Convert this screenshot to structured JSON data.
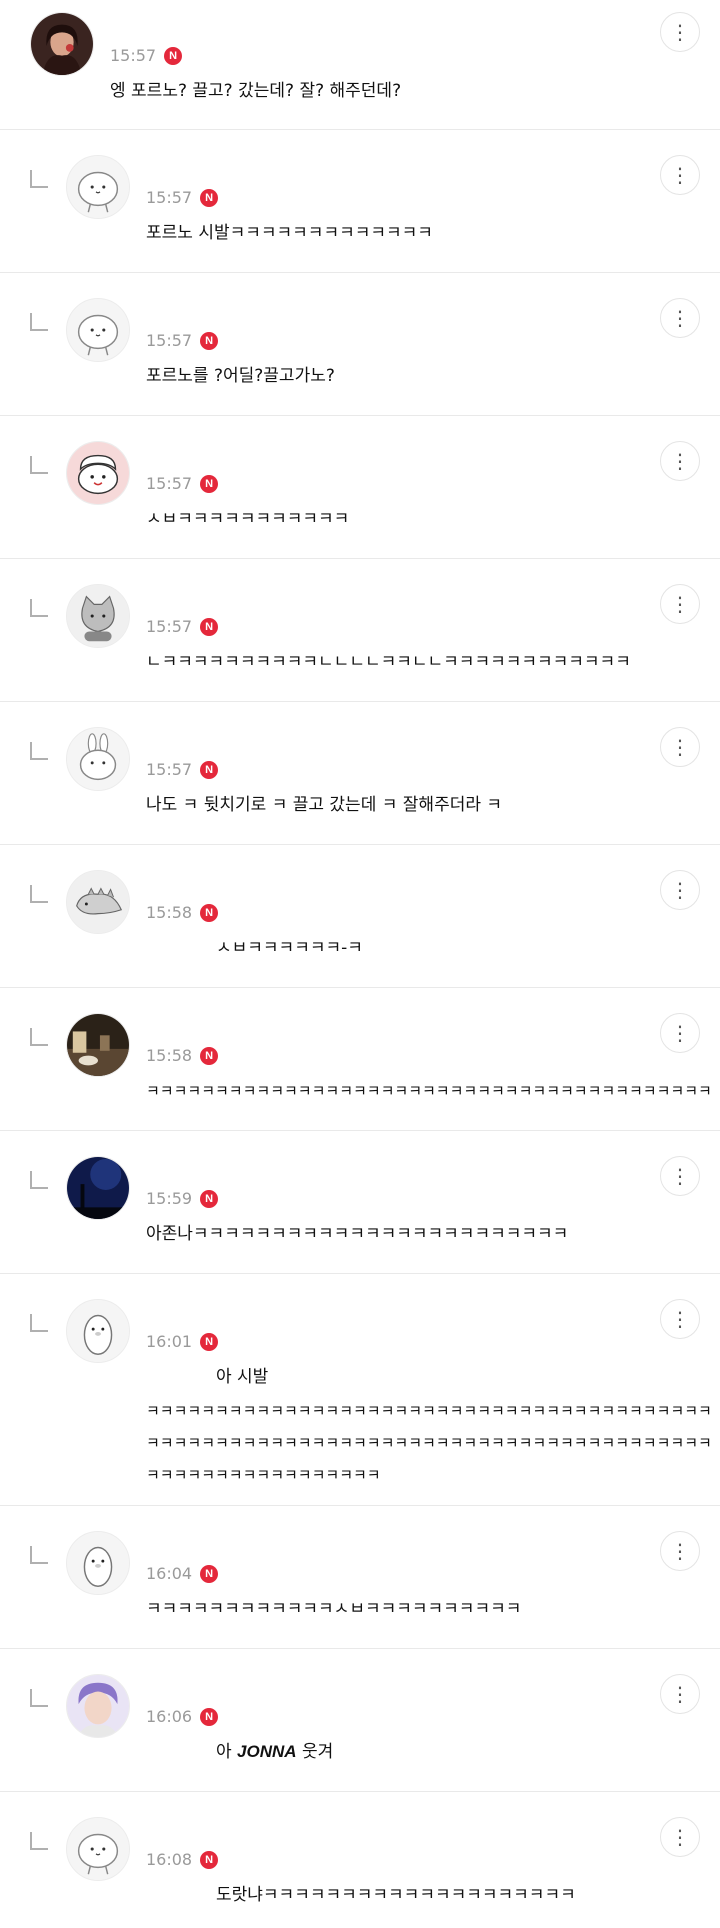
{
  "comments": [
    {
      "time": "15:57",
      "badge": "N",
      "text": "엥 포르노? 끌고? 갔는데? 잘? 해주던데?",
      "avatar": "photo-avatar"
    },
    {
      "time": "15:57",
      "badge": "N",
      "text": "포르노 시발ㅋㅋㅋㅋㅋㅋㅋㅋㅋㅋㅋㅋㅋ",
      "avatar": "blob-avatar"
    },
    {
      "time": "15:57",
      "badge": "N",
      "text": "포르노를 ?어딜?끌고가노?",
      "avatar": "blob-avatar"
    },
    {
      "time": "15:57",
      "badge": "N",
      "text": "ㅅㅂㅋㅋㅋㅋㅋㅋㅋㅋㅋㅋㅋ",
      "avatar": "hamster-avatar"
    },
    {
      "time": "15:57",
      "badge": "N",
      "text": "ㄴㅋㅋㅋㅋㅋㅋㅋㅋㅋㅋㄴㄴㄴㄴㅋㅋㄴㄴㅋㅋㅋㅋㅋㅋㅋㅋㅋㅋㅋㅋ",
      "avatar": "cat-avatar"
    },
    {
      "time": "15:57",
      "badge": "N",
      "text": "나도 ㅋ 뒷치기로 ㅋ 끌고 갔는데 ㅋ 잘해주더라 ㅋ",
      "avatar": "rabbit-avatar"
    },
    {
      "time": "15:58",
      "badge": "N",
      "text": "ㅅㅂㅋㅋㅋㅋㅋㅋ-ㅋ",
      "avatar": "dino-avatar"
    },
    {
      "time": "15:58",
      "badge": "N",
      "text": "ㅋㅋㅋㅋㅋㅋㅋㅋㅋㅋㅋㅋㅋㅋㅋㅋㅋㅋㅋㅋㅋㅋㅋㅋㅋㅋㅋㅋㅋㅋㅋㅋㅋㅋㅋㅋㅋㅋㅋㅋㅋ",
      "avatar": "room-photo-avatar"
    },
    {
      "time": "15:59",
      "badge": "N",
      "text": "아존나ㅋㅋㅋㅋㅋㅋㅋㅋㅋㅋㅋㅋㅋㅋㅋㅋㅋㅋㅋㅋㅋㅋㅋㅋ",
      "avatar": "night-sky-avatar"
    },
    {
      "time": "16:01",
      "badge": "N",
      "text": "아 시발",
      "lines": [
        "ㅋㅋㅋㅋㅋㅋㅋㅋㅋㅋㅋㅋㅋㅋㅋㅋㅋㅋㅋㅋㅋㅋㅋㅋㅋㅋㅋㅋㅋㅋㅋㅋㅋㅋㅋㅋㅋㅋㅋㅋㅋ",
        "ㅋㅋㅋㅋㅋㅋㅋㅋㅋㅋㅋㅋㅋㅋㅋㅋㅋㅋㅋㅋㅋㅋㅋㅋㅋㅋㅋㅋㅋㅋㅋㅋㅋㅋㅋㅋㅋㅋㅋㅋㅋ",
        "ㅋㅋㅋㅋㅋㅋㅋㅋㅋㅋㅋㅋㅋㅋㅋㅋㅋ"
      ],
      "avatar": "penguin-avatar"
    },
    {
      "time": "16:04",
      "badge": "N",
      "text": "ㅋㅋㅋㅋㅋㅋㅋㅋㅋㅋㅋㅋㅅㅂㅋㅋㅋㅋㅋㅋㅋㅋㅋㅋ",
      "avatar": "penguin-avatar"
    },
    {
      "time": "16:06",
      "badge": "N",
      "text_pre": "아 ",
      "text_bold": "JONNA",
      "text_post": " 웃겨",
      "avatar": "portrait-avatar"
    },
    {
      "time": "16:08",
      "badge": "N",
      "text": "도랏냐ㅋㅋㅋㅋㅋㅋㅋㅋㅋㅋㅋㅋㅋㅋㅋㅋㅋㅋㅋㅋ",
      "avatar": "blob-avatar"
    }
  ],
  "more_icon": "⋮",
  "colors": {
    "badge": "#e4283b",
    "time": "#9a9a9a",
    "divider": "#e9e9e9"
  }
}
